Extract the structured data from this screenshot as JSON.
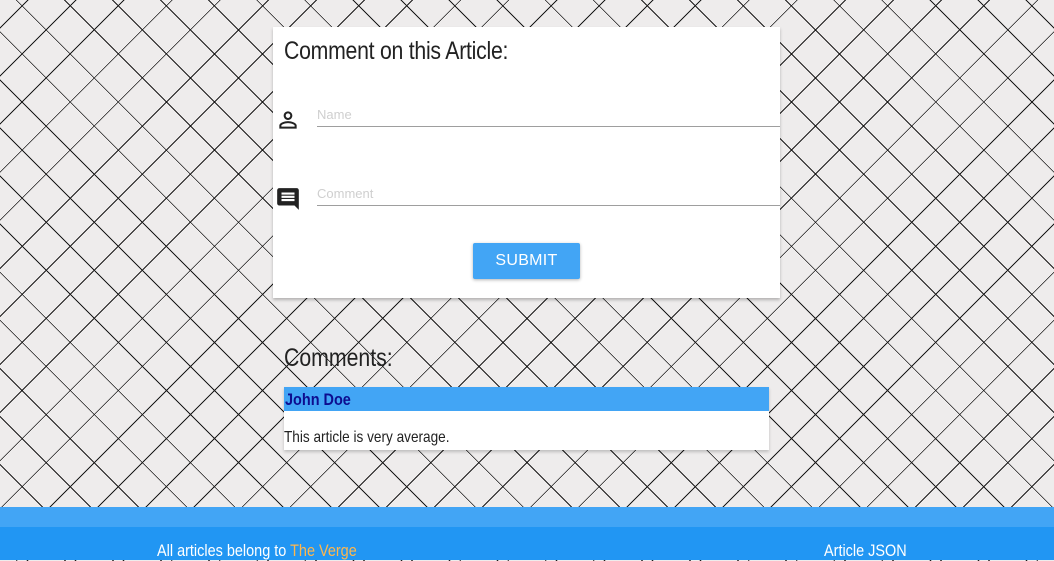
{
  "comment_form": {
    "title": "Comment on this Article:",
    "name_placeholder": "Name",
    "comment_placeholder": "Comment",
    "submit_label": "SUBMIT",
    "name_icon": "person-icon",
    "comment_icon": "comment-icon"
  },
  "comments": {
    "heading": "Comments:",
    "items": [
      {
        "author": "John Doe",
        "text": "This article is very average."
      }
    ]
  },
  "footer": {
    "credit_prefix": "All articles belong to",
    "credit_link": "The Verge",
    "json_link": "Article JSON"
  },
  "colors": {
    "accent": "#42a5f5",
    "footer": "#2196f3",
    "link": "#ffb74d",
    "author_text": "#0d0d8f"
  }
}
